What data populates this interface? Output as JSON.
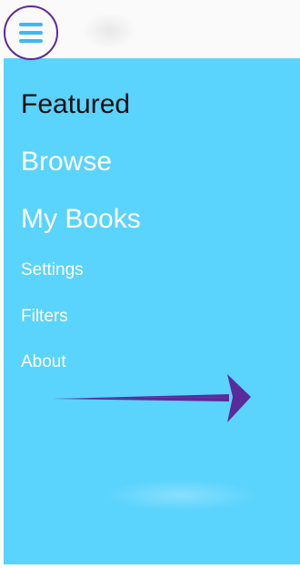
{
  "app": {
    "menu_icon": "hamburger-menu-icon",
    "accent_color": "#5ad3fd",
    "annotation_color": "#5b2a9c"
  },
  "drawer": {
    "items": [
      {
        "label": "Featured",
        "selected": true
      },
      {
        "label": "Browse",
        "selected": false
      },
      {
        "label": "My Books",
        "selected": false
      },
      {
        "label": "Settings",
        "selected": false
      },
      {
        "label": "Filters",
        "selected": false
      },
      {
        "label": "About",
        "selected": false
      }
    ]
  },
  "annotation": {
    "icon": "swipe-right-arrow-icon"
  }
}
